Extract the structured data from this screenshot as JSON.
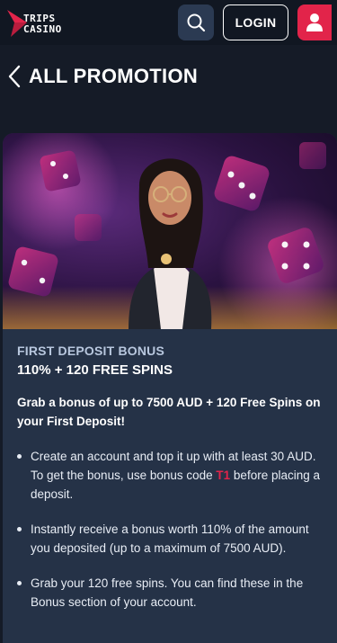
{
  "header": {
    "logo_text": [
      "TRIPS",
      "CASINO"
    ],
    "login_label": "LOGIN",
    "icons": {
      "search": "search-icon",
      "user": "user-icon"
    }
  },
  "titlebar": {
    "title": "ALL PROMOTION",
    "back_icon": "chevron-left-icon"
  },
  "promotion": {
    "kicker": "FIRST DEPOSIT BONUS",
    "title": "110% + 120 FREE SPINS",
    "lead": "Grab a bonus of up to 7500 AUD + 120 Free Spins on your First Deposit!",
    "items": [
      {
        "before": "Create an account and top it up with at least 30 AUD. To get the bonus, use bonus code ",
        "code": "T1",
        "after": " before placing a deposit."
      },
      {
        "text": "Instantly receive a bonus worth 110% of the amount you deposited (up to a maximum of 7500 AUD)."
      },
      {
        "text": "Grab your 120 free spins. You can find these in the Bonus section of your account."
      }
    ]
  },
  "colors": {
    "background": "#151b27",
    "header": "#111722",
    "card": "#253247",
    "accent": "#e2244a",
    "search_button": "#2b3a52"
  }
}
